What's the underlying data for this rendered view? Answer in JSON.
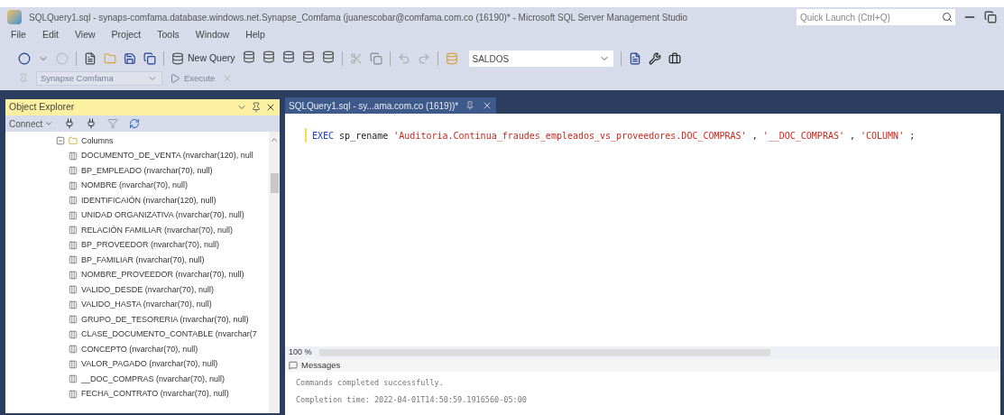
{
  "window": {
    "title": "SQLQuery1.sql - synaps-comfama.database.windows.net.Synapse_Comfama (juanescobar@comfama.com.co (16190)* - Microsoft SQL Server Management Studio",
    "quick_launch": {
      "placeholder": "Quick Launch (Ctrl+Q)"
    }
  },
  "menu": [
    "File",
    "Edit",
    "View",
    "Project",
    "Tools",
    "Window",
    "Help"
  ],
  "toolbar": {
    "new_query": "New Query",
    "database": "SALDOS"
  },
  "toolbar2": {
    "server": "Synapse Comfama",
    "execute": "Execute",
    "disabled": true
  },
  "object_explorer": {
    "title": "Object Explorer",
    "connect": "Connect",
    "tree": [
      {
        "label": "Columns",
        "expanded": true,
        "children": [
          {
            "label": "DOCUMENTO_DE_VENTA (nvarchar(120), null"
          },
          {
            "label": "BP_EMPLEADO (nvarchar(70), null)"
          },
          {
            "label": "NOMBRE (nvarchar(70), null)"
          },
          {
            "label": "IDENTIFICAIÓN (nvarchar(120), null)"
          },
          {
            "label": "UNIDAD ORGANIZATIVA (nvarchar(70), null)"
          },
          {
            "label": "RELACIÓN FAMILIAR (nvarchar(70), null)"
          },
          {
            "label": "BP_PROVEEDOR (nvarchar(70), null)"
          },
          {
            "label": "BP_FAMILIAR (nvarchar(70), null)"
          },
          {
            "label": "NOMBRE_PROVEEDOR (nvarchar(70), null)"
          },
          {
            "label": "VALIDO_DESDE (nvarchar(70), null)"
          },
          {
            "label": "VALIDO_HASTA (nvarchar(70), null)"
          },
          {
            "label": "GRUPO_DE_TESORERIA (nvarchar(70), null)"
          },
          {
            "label": "CLASE_DOCUMENTO_CONTABLE (nvarchar(7"
          },
          {
            "label": "CONCEPTO (nvarchar(70), null)"
          },
          {
            "label": "VALOR_PAGADO (nvarchar(70), null)"
          },
          {
            "label": "__DOC_COMPRAS (nvarchar(70), null)"
          },
          {
            "label": "FECHA_CONTRATO (nvarchar(70), null)"
          }
        ]
      }
    ]
  },
  "editor": {
    "tab": {
      "label": "SQLQuery1.sql - sy...ama.com.co (1619))*",
      "selected": true
    },
    "code": [
      {
        "kind": "keyword",
        "text": "EXEC"
      },
      {
        "kind": "plain",
        "text": "sp_rename"
      },
      {
        "kind": "string",
        "text": "'Auditoria.Continua_fraudes_empleados_vs_proveedores.DOC_COMPRAS'"
      },
      {
        "kind": "plain",
        "text": ","
      },
      {
        "kind": "string",
        "text": "'__DOC_COMPRAS'"
      },
      {
        "kind": "plain",
        "text": ","
      },
      {
        "kind": "string",
        "text": "'COLUMN'"
      },
      {
        "kind": "plain",
        "text": ";"
      }
    ],
    "zoom": "100 %"
  },
  "results": {
    "tab": "Messages",
    "messages": [
      "Commands completed successfully.",
      "Completion time: 2022-04-01T14:50:59.1916560-05:00"
    ]
  }
}
